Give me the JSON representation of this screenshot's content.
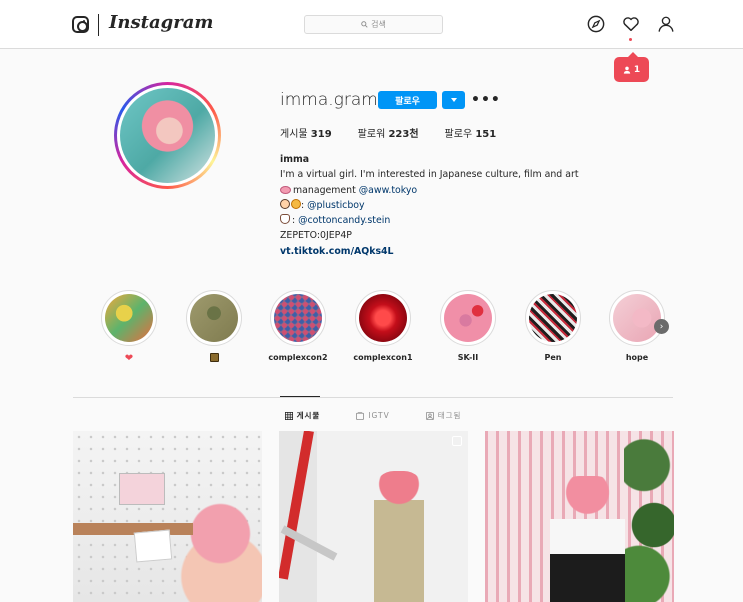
{
  "header": {
    "logo_text": "Instagram",
    "search_placeholder": "검색",
    "notification_count": "1"
  },
  "profile": {
    "username": "imma.gram",
    "follow_label": "팔로우",
    "more_label": "•••",
    "stats": {
      "posts_label": "게시물",
      "posts_value": "319",
      "followers_label": "팔로워",
      "followers_value": "223천",
      "following_label": "팔로우",
      "following_value": "151"
    },
    "bio": {
      "name": "imma",
      "line1": "I'm a virtual girl. I'm interested in Japanese culture, film and art",
      "line2_prefix": "management ",
      "line2_tag": "@aww.tokyo",
      "line3_sep": ": ",
      "line3_tag": "@plusticboy",
      "line4_sep": ": ",
      "line4_tag": "@cottoncandy.stein",
      "line5": "ZEPETO:0JEP4P",
      "link": "vt.tiktok.com/AQks4L"
    }
  },
  "highlights": [
    {
      "label": "",
      "icon": "heart-icon",
      "color": "#ed4956"
    },
    {
      "label": "",
      "icon": "notebook-icon"
    },
    {
      "label": "complexcon2"
    },
    {
      "label": "complexcon1"
    },
    {
      "label": "SK-II"
    },
    {
      "label": "Pen"
    },
    {
      "label": "hope"
    }
  ],
  "tabs": [
    {
      "label": "게시물",
      "icon": "grid-icon",
      "active": true
    },
    {
      "label": "IGTV",
      "icon": "igtv-icon",
      "active": false
    },
    {
      "label": "태그됨",
      "icon": "tagged-icon",
      "active": false
    }
  ],
  "colors": {
    "accent": "#0095f6",
    "notification": "#ed4956",
    "link": "#00376b"
  }
}
